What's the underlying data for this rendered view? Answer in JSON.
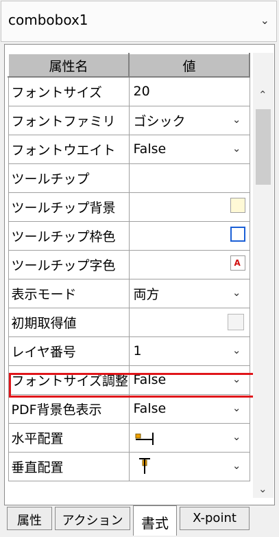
{
  "combo": {
    "value": "combobox1"
  },
  "header": {
    "name": "属性名",
    "value": "値"
  },
  "rows": [
    {
      "name": "フォントサイズ",
      "value": "20"
    },
    {
      "name": "フォントファミリ",
      "value": "ゴシック"
    },
    {
      "name": "フォントウエイト",
      "value": "False"
    },
    {
      "name": "ツールチップ",
      "value": ""
    },
    {
      "name": "ツールチップ背景",
      "value": ""
    },
    {
      "name": "ツールチップ枠色",
      "value": ""
    },
    {
      "name": "ツールチップ字色",
      "value": ""
    },
    {
      "name": "表示モード",
      "value": "両方"
    },
    {
      "name": "初期取得値",
      "value": ""
    },
    {
      "name": "レイヤ番号",
      "value": "1"
    },
    {
      "name": "フォントサイズ調整",
      "value": "False"
    },
    {
      "name": "PDF背景色表示",
      "value": "False"
    },
    {
      "name": "水平配置",
      "value": ""
    },
    {
      "name": "垂直配置",
      "value": ""
    }
  ],
  "tabs": [
    "属性",
    "アクション",
    "書式",
    "X-point"
  ],
  "active_tab": "書式",
  "colors": {
    "highlight": "#e0151a",
    "header_bg": "#c0c0c0"
  },
  "icons": {
    "combo_arrow": "chevron-down-icon",
    "tooltip_bg": "yellow-swatch-icon",
    "tooltip_border": "blue-frame-icon",
    "tooltip_text": "letter-a-icon",
    "hAlign": "align-left-icon",
    "vAlign": "align-top-icon"
  }
}
